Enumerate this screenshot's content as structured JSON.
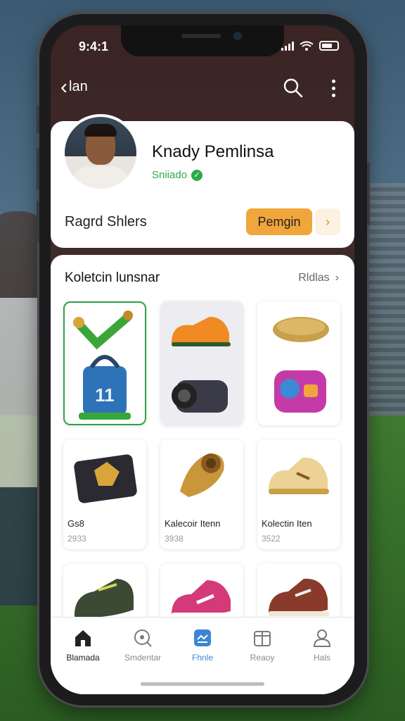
{
  "status_bar": {
    "time": "9:4:1"
  },
  "header": {
    "back_label": "lan"
  },
  "profile": {
    "name": "Knady Pemlinsa",
    "status": "Sniiado",
    "subtitle": "Ragrd Shlers",
    "primary_button": "Pemgin",
    "secondary_button": "›"
  },
  "collection": {
    "title": "Koletcin lunsnar",
    "see_all": "Rldlas",
    "items": [
      {
        "label": "",
        "year": ""
      },
      {
        "label": "",
        "year": ""
      },
      {
        "label": "",
        "year": ""
      },
      {
        "label": "Gs8",
        "year": "2933"
      },
      {
        "label": "Kalecoir Itenn",
        "year": "3938"
      },
      {
        "label": "Kolectin Iten",
        "year": "3522"
      },
      {
        "label": "",
        "year": ""
      },
      {
        "label": "",
        "year": ""
      },
      {
        "label": "",
        "year": ""
      }
    ]
  },
  "tabs": [
    {
      "label": "Blamada",
      "icon": "home-icon"
    },
    {
      "label": "Smdentar",
      "icon": "search-icon"
    },
    {
      "label": "Fhnle",
      "icon": "collection-icon"
    },
    {
      "label": "Reaoy",
      "icon": "box-icon"
    },
    {
      "label": "Hals",
      "icon": "profile-icon"
    }
  ],
  "colors": {
    "accent": "#f0a63a",
    "verified": "#2eaa4a",
    "tab_active": "#3a86d6",
    "header_bg": "#3a2424"
  }
}
